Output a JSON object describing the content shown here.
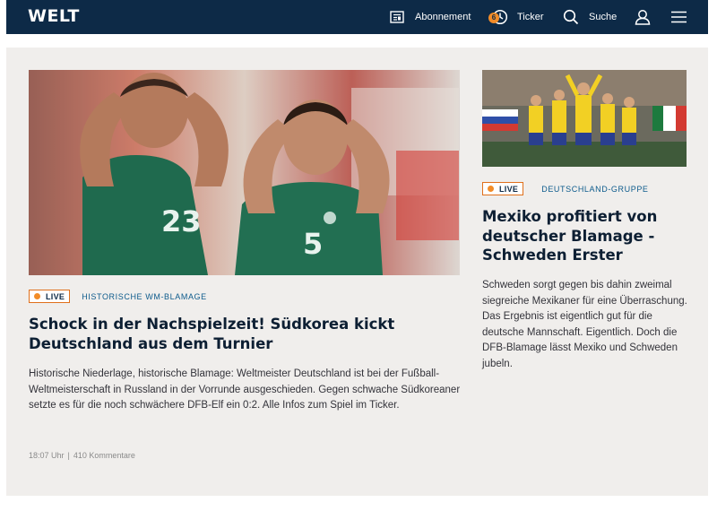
{
  "header": {
    "logo": "WELT",
    "nav": {
      "subscription_label": "Abonnement",
      "ticker_label": "Ticker",
      "ticker_count": "6",
      "search_label": "Suche"
    }
  },
  "main_article": {
    "live_label": "LIVE",
    "topic": "HISTORISCHE WM-BLAMAGE",
    "headline": "Schock in der Nachspielzeit! Südkorea kickt Deutschland aus dem Turnier",
    "teaser": "Historische Niederlage, historische Blamage: Weltmeister Deutschland ist bei der Fußball-Weltmeisterschaft in Russland in der Vorrunde ausgeschieden. Gegen schwache Südkoreaner setzte es für die noch schwächere DFB-Elf ein 0:2. Alle Infos zum Spiel im Ticker.",
    "time": "18:07 Uhr",
    "comments": "410 Kommentare"
  },
  "side_article": {
    "live_label": "LIVE",
    "topic": "DEUTSCHLAND-GRUPPE",
    "headline": "Mexiko profitiert von deutscher Blamage - Schweden Erster",
    "teaser": "Schweden sorgt gegen bis dahin zweimal siegreiche Mexikaner für eine Überraschung. Das Ergebnis ist eigentlich gut für die deutsche Mannschaft. Eigentlich. Doch die DFB-Blamage lässt Mexiko und Schweden jubeln."
  },
  "colors": {
    "header_bg": "#0d2a47",
    "accent": "#f28c28",
    "panel_bg": "#f0eeec",
    "topic_color": "#0d5b8c"
  },
  "icons": [
    "newspaper-icon",
    "ticker-clock-icon",
    "search-icon",
    "user-icon",
    "menu-icon"
  ]
}
